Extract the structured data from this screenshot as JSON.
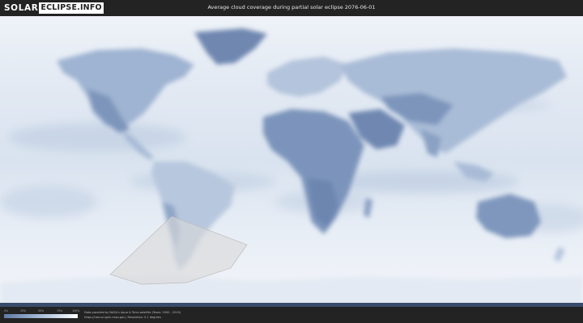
{
  "header": {
    "logo_part1": "SOLAR",
    "logo_part2": "ECLIPSE.INFO",
    "title": "Average cloud coverage during partial solar eclipse 2076-06-01"
  },
  "legend": {
    "labels": [
      "0%",
      "25%",
      "50%",
      "75%",
      "100%"
    ],
    "scale_colors": [
      "#5f7aa3",
      "#8ea6c6",
      "#c4d3e6",
      "#ffffff"
    ]
  },
  "credits": {
    "line1": "Data provided by NASA's Aqua & Terra satellite (Years: 2000 - 2019)",
    "line2": "https://neo.sci.gsfc.nasa.gov | Resolution: 0.1 degrees"
  },
  "colors": {
    "background": "#1e1e1e",
    "ocean_clouds": "#e6edf6",
    "clear_land": "#7d95bb",
    "eclipse_zone": "#d6d6d6"
  }
}
